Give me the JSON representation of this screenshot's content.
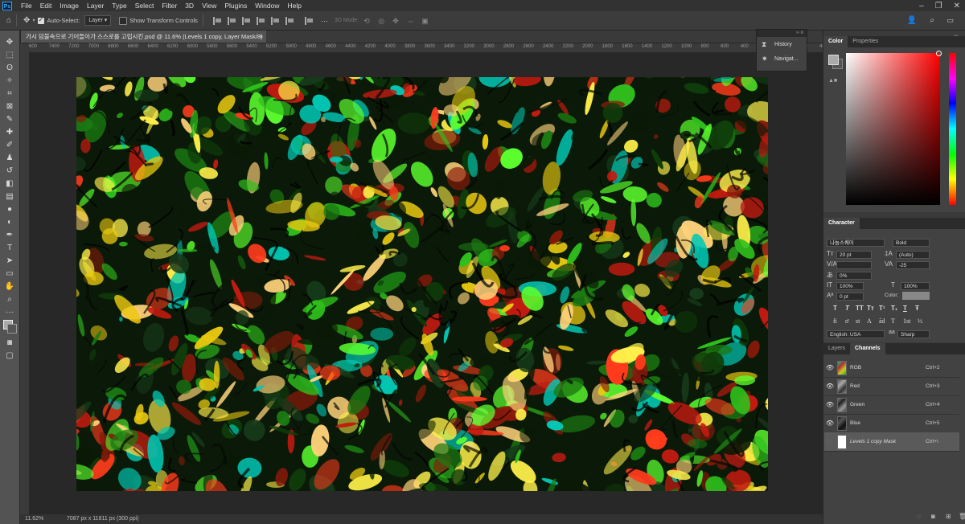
{
  "menubar": {
    "app_badge": "Ps",
    "items": [
      "File",
      "Edit",
      "Image",
      "Layer",
      "Type",
      "Select",
      "Filter",
      "3D",
      "View",
      "Plugins",
      "Window",
      "Help"
    ]
  },
  "options_bar": {
    "auto_select_label": "Auto-Select:",
    "auto_select_checked": true,
    "auto_select_target": "Layer",
    "show_transform_label": "Show Transform Controls",
    "show_transform_checked": false,
    "mode_3d_label": "3D Mode:"
  },
  "document_tab": {
    "title": "가시 덤불속으로 기어들어가 스스로를 고립시킨.psd @ 11.6% (Levels 1 copy, Layer Mask/8)",
    "close_glyph": "×"
  },
  "ruler": {
    "ticks": [
      "600",
      "7400",
      "7200",
      "7000",
      "6800",
      "6600",
      "6400",
      "6200",
      "6000",
      "5800",
      "5600",
      "5400",
      "5200",
      "5000",
      "4800",
      "4600",
      "4400",
      "4200",
      "4000",
      "3800",
      "3600",
      "3400",
      "3200",
      "3000",
      "2800",
      "2600",
      "2400",
      "2200",
      "2000",
      "1800",
      "1600",
      "1400",
      "1200",
      "1000",
      "800",
      "600",
      "400",
      "200",
      "0",
      "200",
      "40"
    ]
  },
  "status_bar": {
    "zoom": "11.62%",
    "doc_info": "7087 px x 11811 px (300 ppi)"
  },
  "mini_panel": {
    "history_label": "History",
    "navigator_label": "Navigat..."
  },
  "color_panel": {
    "tabs": [
      "Color",
      "Properties"
    ],
    "active_tab": "Color",
    "foreground": "#aaaaaa",
    "background": "#555555"
  },
  "character_panel": {
    "tab": "Character",
    "font_family": "나눔스퀘어",
    "font_style": "Bold",
    "font_size": "20 pt",
    "leading": "(Auto)",
    "kerning": "",
    "tracking": "-25",
    "tsume": "0%",
    "vertical_scale": "100%",
    "horizontal_scale": "100%",
    "baseline_shift": "0 pt",
    "color_label": "Color:",
    "language": "English: USA",
    "antialias": "Sharp",
    "style_glyphs": [
      "T",
      "T",
      "TT",
      "Tт",
      "T¹",
      "T₁",
      "T",
      "Ŧ"
    ],
    "opentype_glyphs": [
      "fi",
      "ơ",
      "st",
      "A",
      "ād",
      "T",
      "1st",
      "½"
    ]
  },
  "channels_panel": {
    "tabs": [
      "Layers",
      "Channels"
    ],
    "active_tab": "Channels",
    "rows": [
      {
        "name": "RGB",
        "shortcut": "Ctrl+2",
        "visible": true
      },
      {
        "name": "Red",
        "shortcut": "Ctrl+3",
        "visible": true
      },
      {
        "name": "Green",
        "shortcut": "Ctrl+4",
        "visible": true
      },
      {
        "name": "Blue",
        "shortcut": "Ctrl+5",
        "visible": true
      },
      {
        "name": "Levels 1 copy Mask",
        "shortcut": "Ctrl+\\",
        "visible": false
      }
    ]
  },
  "colors": {
    "menubar_bg": "#323232",
    "panel_bg": "#424242",
    "canvas_bg": "#282828",
    "accent": "#31a8ff"
  }
}
